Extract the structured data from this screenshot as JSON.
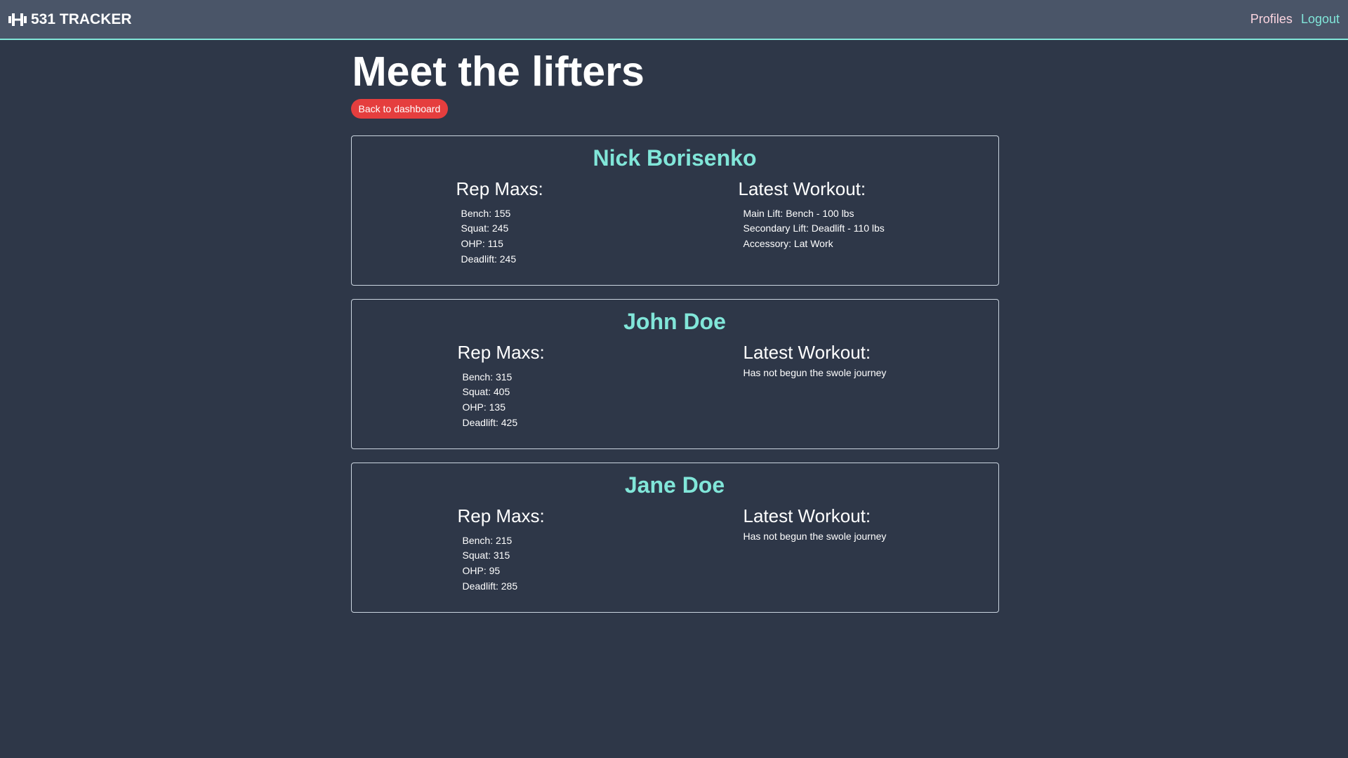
{
  "nav": {
    "brand": "531 TRACKER",
    "brand_icon": "dumbbell-icon",
    "links": [
      "Profiles",
      "Logout"
    ]
  },
  "page": {
    "title": "Meet the lifters",
    "back_button": "Back to dashboard"
  },
  "labels": {
    "rep_maxs": "Rep Maxs:",
    "latest_workout": "Latest Workout:"
  },
  "lifters": [
    {
      "name": "Nick Borisenko",
      "rep_maxs": [
        "Bench: 155",
        "Squat: 245",
        "OHP: 115",
        "Deadlift: 245"
      ],
      "latest_workout": [
        "Main Lift: Bench - 100 lbs",
        "Secondary Lift: Deadlift - 110 lbs",
        "Accessory: Lat Work"
      ],
      "no_workout_text": ""
    },
    {
      "name": "John Doe",
      "rep_maxs": [
        "Bench: 315",
        "Squat: 405",
        "OHP: 135",
        "Deadlift: 425"
      ],
      "latest_workout": [],
      "no_workout_text": "Has not begun the swole journey"
    },
    {
      "name": "Jane Doe",
      "rep_maxs": [
        "Bench: 215",
        "Squat: 315",
        "OHP: 95",
        "Deadlift: 285"
      ],
      "latest_workout": [],
      "no_workout_text": "Has not begun the swole journey"
    }
  ],
  "colors": {
    "background": "#2e3748",
    "navbar": "#4a5568",
    "accent": "#81e6d9",
    "danger": "#e53e3e",
    "profiles_link": "#fbd5e0"
  }
}
